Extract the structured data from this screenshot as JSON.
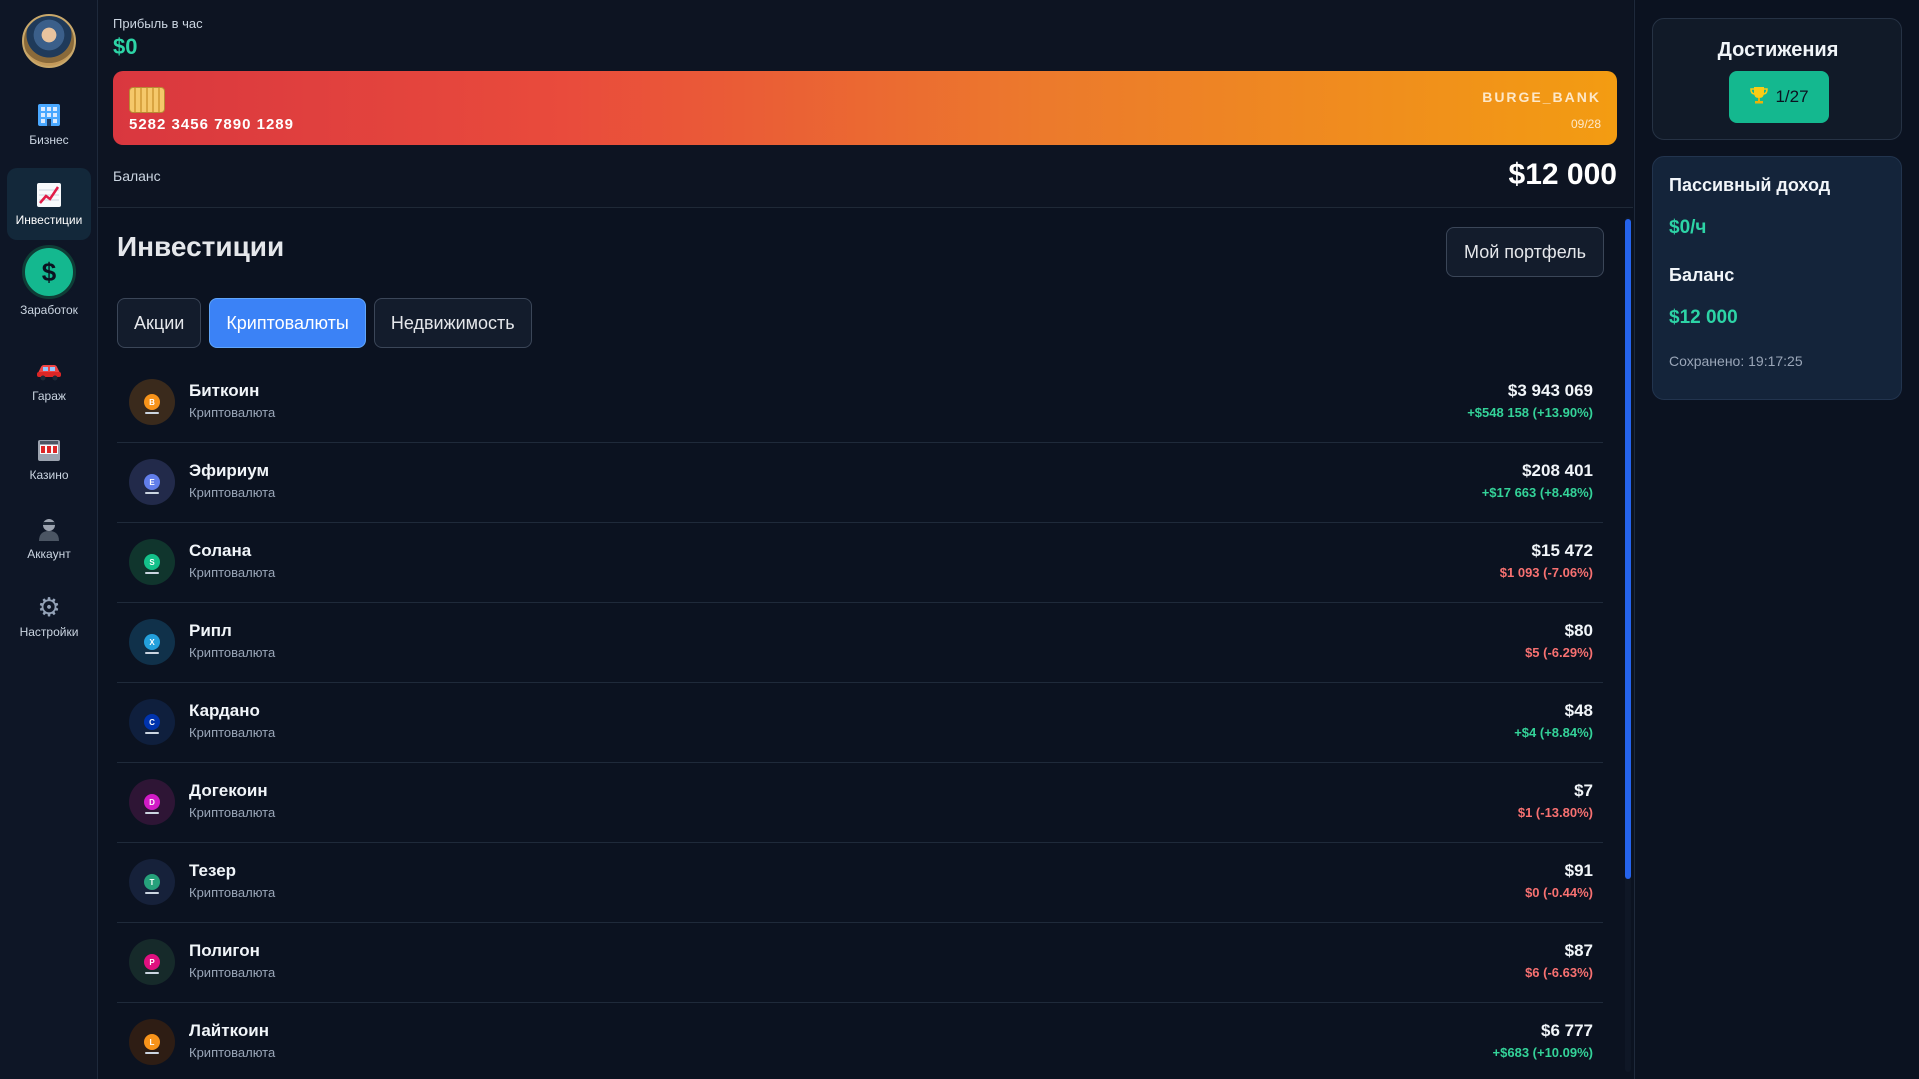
{
  "sidebar": {
    "items": [
      {
        "label": "Бизнес",
        "icon": "building-icon"
      },
      {
        "label": "Инвестиции",
        "icon": "chart-up-icon",
        "active": true
      },
      {
        "label": "Заработок",
        "icon": "dollar-icon",
        "symbol": "$"
      },
      {
        "label": "Гараж",
        "icon": "car-icon"
      },
      {
        "label": "Казино",
        "icon": "slot-machine-icon"
      },
      {
        "label": "Аккаунт",
        "icon": "user-icon"
      },
      {
        "label": "Настройки",
        "icon": "gear-icon",
        "symbol": "⚙"
      }
    ]
  },
  "header": {
    "profit_label": "Прибыль в час",
    "profit_value": "$0",
    "card": {
      "number": "5282 3456 7890 1289",
      "bank": "BURGE_BANK",
      "expiry": "09/28"
    },
    "balance_label": "Баланс",
    "balance_value": "$12 000"
  },
  "investments": {
    "title": "Инвестиции",
    "portfolio_button": "Мой портфель",
    "tabs": [
      {
        "label": "Акции",
        "active": false
      },
      {
        "label": "Криптовалюты",
        "active": true
      },
      {
        "label": "Недвижимость",
        "active": false
      }
    ],
    "items": [
      {
        "name": "Биткоин",
        "type": "Криптовалюта",
        "price": "$3 943 069",
        "change": "+$548 158 (+13.90%)",
        "trend": "up",
        "letter": "B",
        "color": "#f7931a",
        "bg": "#3a2a1c"
      },
      {
        "name": "Эфириум",
        "type": "Криптовалюта",
        "price": "$208 401",
        "change": "+$17 663 (+8.48%)",
        "trend": "up",
        "letter": "E",
        "color": "#627eea",
        "bg": "#222a4a"
      },
      {
        "name": "Солана",
        "type": "Криптовалюта",
        "price": "$15 472",
        "change": "$1 093 (-7.06%)",
        "trend": "down",
        "letter": "S",
        "color": "#14c08a",
        "bg": "#10352d"
      },
      {
        "name": "Рипл",
        "type": "Криптовалюта",
        "price": "$80",
        "change": "$5 (-6.29%)",
        "trend": "down",
        "letter": "X",
        "color": "#23a0dc",
        "bg": "#10314a"
      },
      {
        "name": "Кардано",
        "type": "Криптовалюта",
        "price": "$48",
        "change": "+$4 (+8.84%)",
        "trend": "up",
        "letter": "C",
        "color": "#0033ad",
        "bg": "#0f1f3d"
      },
      {
        "name": "Догекоин",
        "type": "Криптовалюта",
        "price": "$7",
        "change": "$1 (-13.80%)",
        "trend": "down",
        "letter": "D",
        "color": "#d21bc6",
        "bg": "#2e1535"
      },
      {
        "name": "Тезер",
        "type": "Криптовалюта",
        "price": "$91",
        "change": "$0 (-0.44%)",
        "trend": "down",
        "letter": "T",
        "color": "#26a17b",
        "bg": "#16213a"
      },
      {
        "name": "Полигон",
        "type": "Криптовалюта",
        "price": "$87",
        "change": "$6 (-6.63%)",
        "trend": "down",
        "letter": "P",
        "color": "#e0107f",
        "bg": "#162a2a"
      },
      {
        "name": "Лайткоин",
        "type": "Криптовалюта",
        "price": "$6 777",
        "change": "+$683 (+10.09%)",
        "trend": "up",
        "letter": "L",
        "color": "#f7931a",
        "bg": "#2e1d14"
      }
    ]
  },
  "right_panel": {
    "achievements_title": "Достижения",
    "achievements_count": "1/27",
    "passive_title": "Пассивный доход",
    "passive_value": "$0/ч",
    "balance_title": "Баланс",
    "balance_value": "$12 000",
    "saved": "Сохранено: 19:17:25"
  },
  "colors": {
    "accent": "#14b88f",
    "tab_active": "#3b82f6",
    "positive": "#34d399",
    "negative": "#f87171"
  }
}
